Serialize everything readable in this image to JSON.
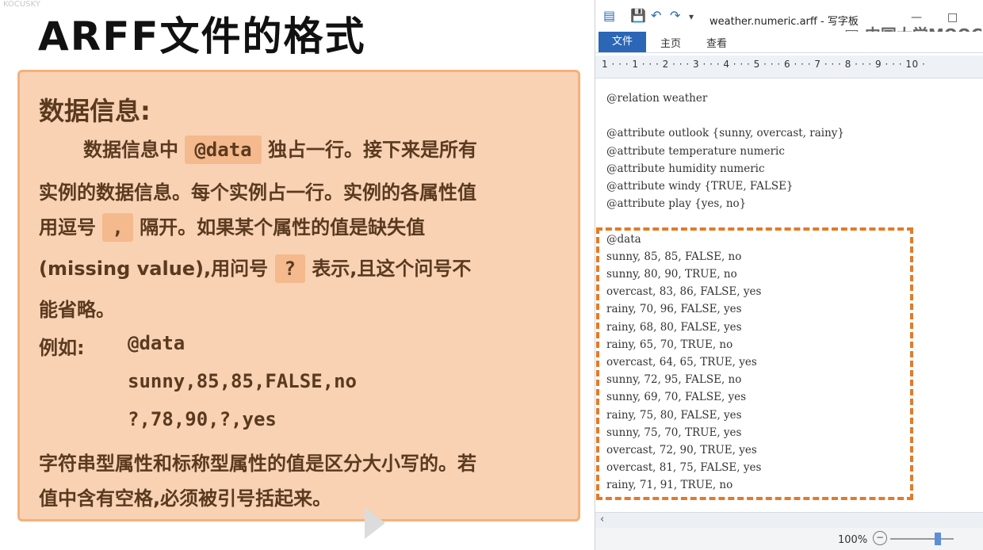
{
  "slide": {
    "brand": "KOCUSKY",
    "title": "ARFF文件的格式",
    "heading": "数据信息:",
    "para1_prefix": "数据信息中",
    "para1_code": "@data",
    "para1_suffix": "独占一行。接下来是所有",
    "para2": "实例的数据信息。每个实例占一行。实例的各属性值",
    "para3_prefix": "用逗号",
    "para3_code": ",",
    "para3_suffix": "隔开。如果某个属性的值是缺失值",
    "para4_prefix": "(missing value),用问号",
    "para4_code": "?",
    "para4_suffix": "表示,且这个问号不",
    "para5": "能省略。",
    "example_label": "例如:",
    "example_lines": [
      "@data",
      "sunny,85,85,FALSE,no",
      "?,78,90,?,yes"
    ],
    "para6": "字符串型属性和标称型属性的值是区分大小写的。若",
    "para7": "值中含有空格,必须被引号括起来。"
  },
  "wordpad": {
    "window_title": "weather.numeric.arff - 写字板",
    "watermark": "中国大学MOOC",
    "tabs": [
      "文件",
      "主页",
      "查看"
    ],
    "ruler": "1 · · · 1 · · · 2 · · · 3 · · · 4 · · · 5 · · · 6 · · · 7 · · · 8 · · · 9 · · · 10 ·",
    "zoom": "100%",
    "lines": [
      "@relation weather",
      "",
      "@attribute outlook {sunny, overcast, rainy}",
      "@attribute temperature numeric",
      "@attribute humidity numeric",
      "@attribute windy {TRUE, FALSE}",
      "@attribute play {yes, no}",
      "",
      "@data",
      "sunny, 85, 85, FALSE, no",
      "sunny, 80, 90, TRUE, no",
      "overcast, 83, 86, FALSE, yes",
      "rainy, 70, 96, FALSE, yes",
      "rainy, 68, 80, FALSE, yes",
      "rainy, 65, 70, TRUE, no",
      "overcast, 64, 65, TRUE, yes",
      "sunny, 72, 95, FALSE, no",
      "sunny, 69, 70, FALSE, yes",
      "rainy, 75, 80, FALSE, yes",
      "sunny, 75, 70, TRUE, yes",
      "overcast, 72, 90, TRUE, yes",
      "overcast, 81, 75, FALSE, yes",
      "rainy, 71, 91, TRUE, no"
    ]
  }
}
